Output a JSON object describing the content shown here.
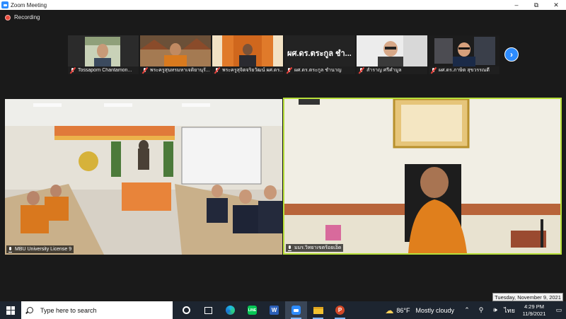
{
  "window": {
    "title": "Zoom Meeting",
    "controls": {
      "minimize": "–",
      "maximize": "⧉",
      "close": "✕"
    }
  },
  "recording": {
    "label": "Recording",
    "color": "#e84b3c"
  },
  "participants_strip": [
    {
      "name": "Tossaporn Chantamon...",
      "muted": true
    },
    {
      "name": "พระครูสุนทรมหาเจติยานุรั...",
      "muted": true
    },
    {
      "name": "พระครูสุจิตจริยวัฒน์ ผศ.ดร...",
      "muted": true
    },
    {
      "name": "ผศ.ดร.ตระกูล ชำนาญ",
      "display_text": "ผศ.ดร.ตระกูล ชำ...",
      "muted": true
    },
    {
      "name": "สำราญ ศรีคำมูล",
      "muted": true
    },
    {
      "name": "ผศ.ดร.ภาษิต สุขวรรณดี",
      "muted": true
    }
  ],
  "next_page_icon": "chevron-right-icon",
  "main_tiles": [
    {
      "name": "MBU University License 9",
      "active_speaker": false
    },
    {
      "name": "มมร.วิทยาเขตร้อยเอ็ด",
      "active_speaker": true
    }
  ],
  "active_speaker_color": "#b8e03a",
  "date_tooltip": "Tuesday, November 9, 2021",
  "taskbar": {
    "search_placeholder": "Type here to search",
    "apps": [
      "cortana-icon",
      "task-view-icon",
      "edge-icon",
      "line-icon",
      "word-icon",
      "zoom-icon",
      "file-explorer-icon",
      "powerpoint-icon"
    ],
    "weather": {
      "temp": "86°F",
      "condition": "Mostly cloudy"
    },
    "language": "ไทย",
    "time": "4:29 PM",
    "date": "11/9/2021"
  }
}
